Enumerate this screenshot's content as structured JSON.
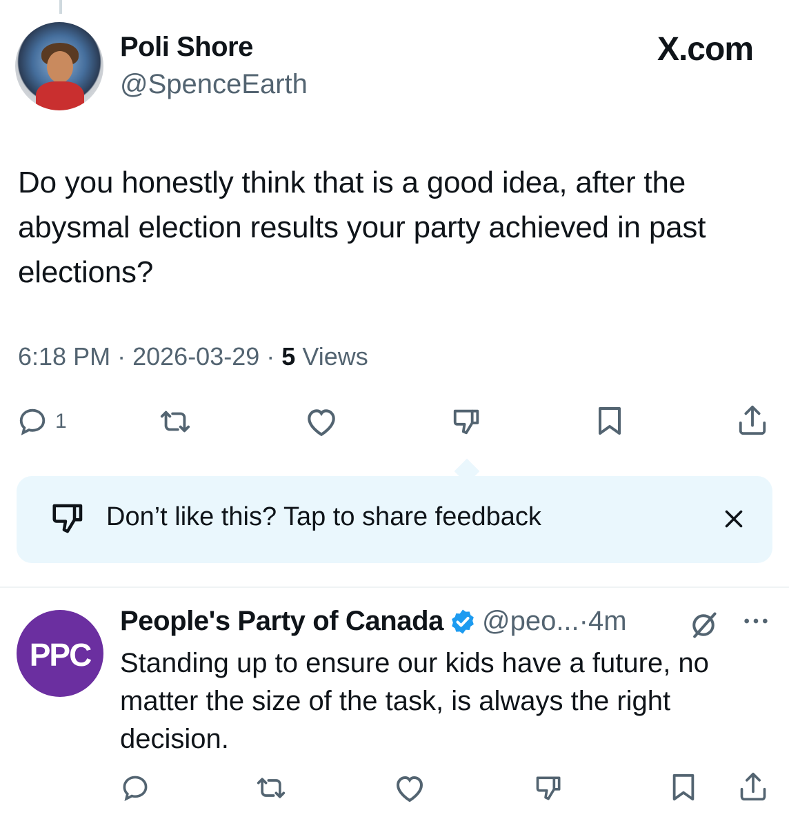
{
  "brand": "X.com",
  "main_tweet": {
    "display_name": "Poli Shore",
    "handle": "@SpenceEarth",
    "text": "Do you honestly think that is a good idea, after the abysmal election results your party achieved in past elections?",
    "time": "6:18 PM",
    "sep": "·",
    "date": "2026-03-29",
    "views_count": "5",
    "views_label": "Views",
    "actions": {
      "reply_count": "1"
    },
    "icons": [
      "reply-icon",
      "repost-icon",
      "like-icon",
      "dislike-icon",
      "bookmark-icon",
      "share-icon"
    ]
  },
  "feedback_card": {
    "text": "Don’t like this? Tap to share feedback",
    "icons": [
      "dislike-icon",
      "close-icon"
    ]
  },
  "second_tweet": {
    "display_name": "People's Party of Canada",
    "avatar_text": "PPC",
    "handle": "@peo...",
    "sep": "·",
    "time": "4m",
    "text": "Standing up to ensure our kids have a future, no matter the size of the task, is always the right decision.",
    "icons": [
      "verified-badge-icon",
      "grok-icon",
      "more-icon",
      "reply-icon",
      "repost-icon",
      "like-icon",
      "dislike-icon",
      "bookmark-icon",
      "share-icon"
    ]
  },
  "colors": {
    "text": "#0f1419",
    "secondary": "#536471",
    "verified": "#1d9bf0",
    "feedback_bg": "#eaf7fd",
    "ppc_purple": "#6b2fa0"
  }
}
